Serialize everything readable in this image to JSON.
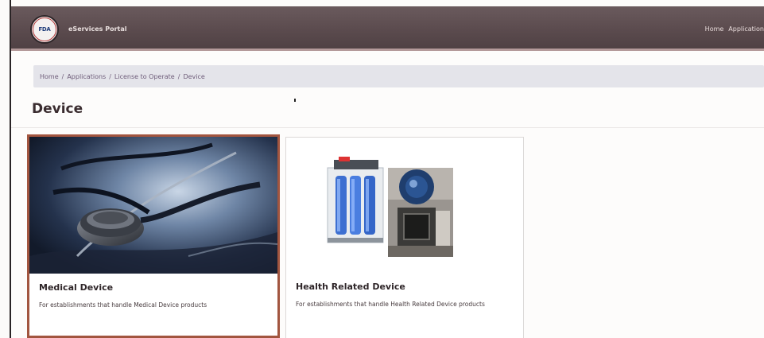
{
  "header": {
    "logo_text": "FDA",
    "brand": "eServices Portal",
    "nav": [
      "Home",
      "Application"
    ]
  },
  "breadcrumb": [
    "Home",
    "Applications",
    "License to Operate",
    "Device"
  ],
  "page_title": "Device",
  "cards": [
    {
      "title": "Medical Device",
      "description": "For establishments that handle Medical Device products",
      "image": "stethoscope-photo",
      "selected": true
    },
    {
      "title": "Health Related Device",
      "description": "For establishments that handle Health Related Device products",
      "image": "water-filter-and-sterilizer-photo",
      "selected": false
    }
  ],
  "colors": {
    "header_bg": "#5a4a4d",
    "selected_border": "#a2553f",
    "breadcrumb_bg": "#e4e4ea"
  }
}
